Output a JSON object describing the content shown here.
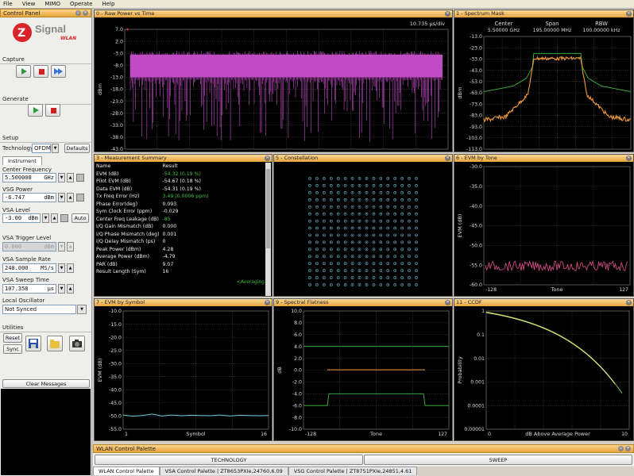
{
  "menu": [
    "File",
    "View",
    "MIMO",
    "Operate",
    "Help"
  ],
  "control_panel": {
    "title": "Control Panel",
    "logo_brand": "Signal",
    "logo_sub": "WLAN",
    "capture": "Capture",
    "generate": "Generate",
    "setup": "Setup",
    "technology_label": "Technology",
    "technology_value": "OFDM",
    "defaults": "Defaults",
    "instrument_tab": "Instrument",
    "center_freq_label": "Center Frequency",
    "center_freq": "5.500000",
    "center_freq_unit": "GHz",
    "vsg_power_label": "VSG Power",
    "vsg_power": "-6.747",
    "vsg_power_unit": "dBm",
    "vsa_level_label": "VSA Level",
    "vsa_level": "-3.00",
    "vsa_level_unit": "dBm",
    "auto": "Auto",
    "vsa_trigger_label": "VSA Trigger Level",
    "vsa_trigger": "0.000",
    "vsa_trigger_unit": "dBm",
    "vsa_sample_label": "VSA Sample Rate",
    "vsa_sample": "240.000",
    "vsa_sample_unit": "MS/s",
    "vsa_sweep_label": "VSA Sweep Time",
    "vsa_sweep": "107.358",
    "vsa_sweep_unit": "µs",
    "lo_label": "Local Oscillator",
    "lo_value": "Not Synced",
    "utilities": "Utilities",
    "reset": "Reset",
    "sync": "Sync",
    "clear_messages": "Clear Messages"
  },
  "panels": {
    "p0": {
      "title": "0 - Raw Power vs Time",
      "scale": "10.735 µs/div",
      "ylabel": "dBm",
      "ticks": [
        "7.0",
        "2.0",
        "-3.0",
        "-8.0",
        "-13.0",
        "-18.0",
        "-23.0",
        "-28.0",
        "-33.0",
        "-38.0",
        "-43.0"
      ]
    },
    "p1": {
      "title": "1 - Spectrum Mask",
      "h1": "Center",
      "h2": "Span",
      "h3": "RBW",
      "v1": "5.50000 GHz",
      "v2": "195.00000 MHz",
      "v3": "100.00000 kHz",
      "ylabel": "dBm",
      "ticks": [
        "-13.0",
        "-23.0",
        "-33.0",
        "-43.0",
        "-53.0",
        "-63.0",
        "-73.0",
        "-83.0",
        "-93.0",
        "-103.0",
        "-113.0"
      ]
    },
    "p3": {
      "title": "3 - Measurement Summary",
      "col_name": "Name",
      "col_result": "Result",
      "averaging": "<Averaging"
    },
    "p5": {
      "title": "5 - Constellation"
    },
    "p6": {
      "title": "6 - EVM by Tone",
      "ylabel": "EVM (dB)",
      "xlabel": "Tone",
      "xmin": "-128",
      "xmax": "127",
      "ticks": [
        "-30.0",
        "-35.0",
        "-40.0",
        "-45.0",
        "-50.0",
        "-55.0",
        "-60.0"
      ]
    },
    "p7": {
      "title": "7 - EVM by Symbol",
      "ylabel": "EVM (dB)",
      "xlabel": "Symbol",
      "xmin": "1",
      "xmax": "16",
      "ticks": [
        "-10.0",
        "-15.0",
        "-20.0",
        "-25.0",
        "-30.0",
        "-35.0",
        "-40.0",
        "-45.0",
        "-50.0",
        "-55.0"
      ]
    },
    "p9": {
      "title": "9 - Spectral Flatness",
      "ylabel": "dB",
      "xlabel": "Tone",
      "xmin": "-128",
      "xmax": "127",
      "ticks": [
        "10.0",
        "8.0",
        "6.0",
        "4.0",
        "2.0",
        "0.0",
        "-2.0",
        "-4.0",
        "-6.0",
        "-8.0",
        "-10.0"
      ]
    },
    "p11": {
      "title": "11 - CCDF",
      "ylabel": "Probability",
      "xlabel": "dB Above Average Power",
      "xmin": "0",
      "xmax": "10",
      "ticks": [
        "1",
        "0.1",
        "0.01",
        "0.001",
        "0.0001",
        "0.00001"
      ]
    }
  },
  "measurements": [
    {
      "name": "EVM (dB)",
      "value": "-54.32 (0.19 %)",
      "green": true
    },
    {
      "name": "Pilot EVM (dB)",
      "value": "-54.67 (0.18 %)",
      "green": false
    },
    {
      "name": "Data EVM (dB)",
      "value": "-54.31 (0.19 %)",
      "green": false
    },
    {
      "name": "Tx Freq Error (Hz)",
      "value": "3.49  (0.0006 ppm)",
      "green": true
    },
    {
      "name": "Phase Error(deg)",
      "value": "0.093",
      "green": false
    },
    {
      "name": "Sym Clock Error (ppm)",
      "value": "-0.029",
      "green": false
    },
    {
      "name": "Center Freq Leakage (dB)",
      "value": "-85",
      "green": true
    },
    {
      "name": "I/Q Gain Mismatch (dB)",
      "value": "0.000",
      "green": false
    },
    {
      "name": "I/Q Phase Mismatch (deg)",
      "value": "0.001",
      "green": false
    },
    {
      "name": "I/Q Delay Mismatch (ps)",
      "value": "0",
      "green": false
    },
    {
      "name": "Peak Power (dBm)",
      "value": "4.28",
      "green": false
    },
    {
      "name": "Average Power (dBm)",
      "value": "-4.79",
      "green": false
    },
    {
      "name": "PAR (dB)",
      "value": "9.07",
      "green": false
    },
    {
      "name": "Result Length (Sym)",
      "value": "16",
      "green": false
    }
  ],
  "palette": {
    "title": "WLAN Control Palette",
    "technology": "TECHNOLOGY",
    "sweep": "SWEEP"
  },
  "statusbar": {
    "tab1": "WLAN Control Palette",
    "tab2": "VSA Control Palette | ZT8653PXIe,24760,6.09",
    "tab3": "VSG Control Palette | ZT8751PXIe,24851,4.61"
  },
  "colors": {
    "title_bar": "#e7a43c",
    "trace_magenta": "#c04dc4",
    "trace_orange": "#f09a3a",
    "mask_green": "#3fbf3f",
    "evm_pink": "#e0508a",
    "grid": "#555555"
  }
}
